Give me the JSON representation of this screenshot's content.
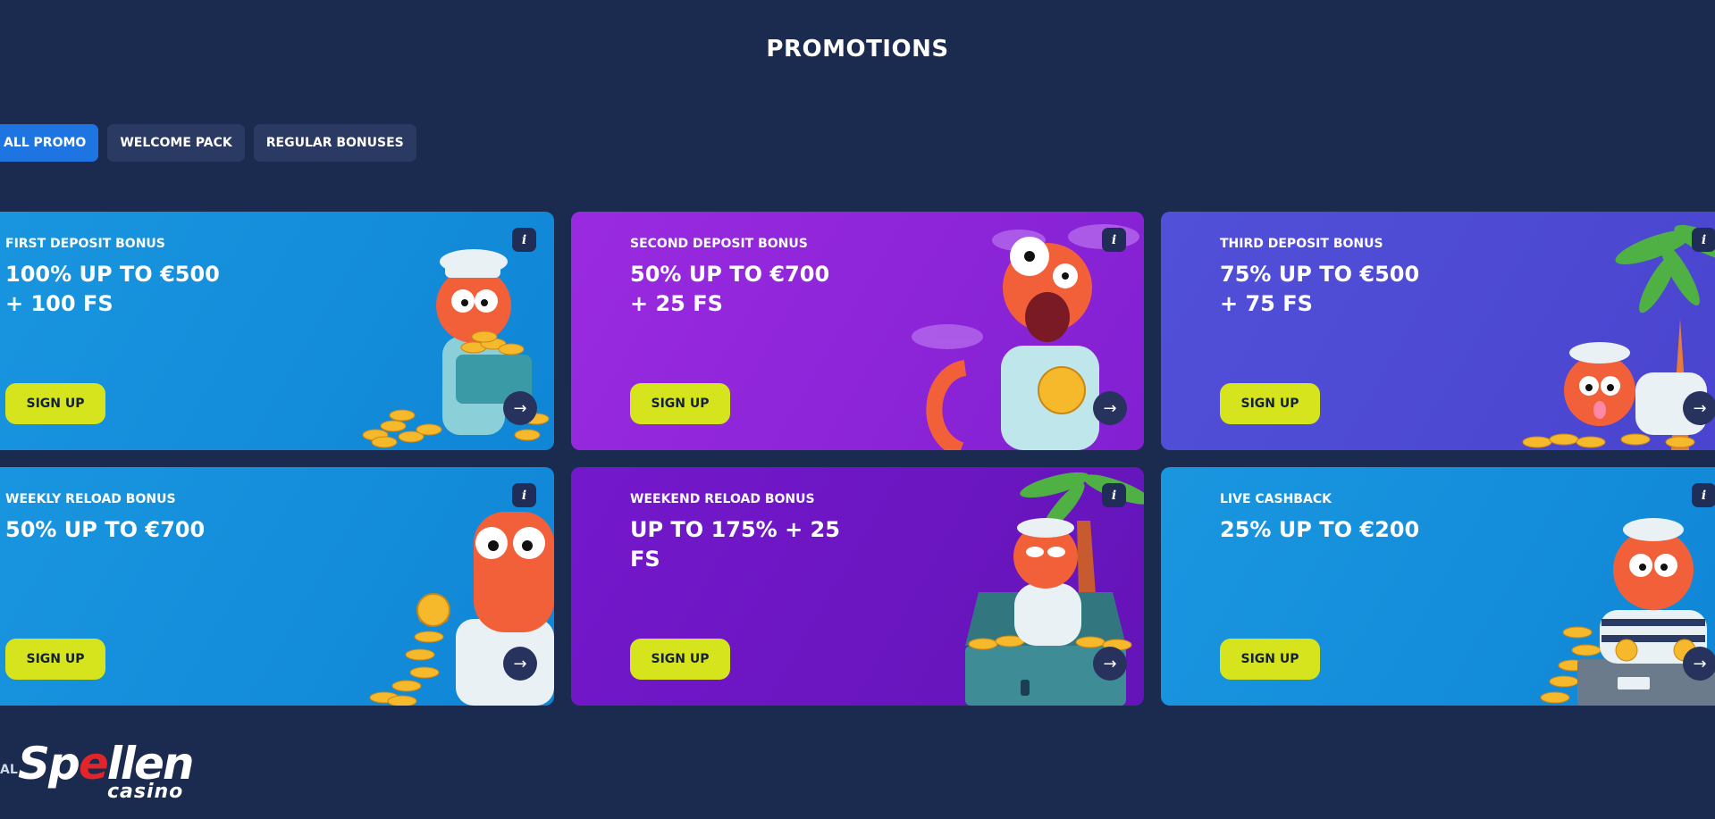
{
  "page": {
    "title": "PROMOTIONS"
  },
  "tabs": [
    {
      "label": "ALL PROMO",
      "active": true
    },
    {
      "label": "WELCOME PACK",
      "active": false
    },
    {
      "label": "REGULAR BONUSES",
      "active": false
    }
  ],
  "cards": [
    {
      "label": "FIRST DEPOSIT BONUS",
      "headline": "100% UP TO €500 + 100 FS",
      "button": "SIGN UP",
      "info": "i",
      "arrow": "→",
      "color": "#1a96df"
    },
    {
      "label": "SECOND DEPOSIT BONUS",
      "headline": "50% UP TO €700 + 25 FS",
      "button": "SIGN UP",
      "info": "i",
      "arrow": "→",
      "color": "#9a2ae0"
    },
    {
      "label": "THIRD DEPOSIT BONUS",
      "headline": "75% UP TO €500 + 75 FS",
      "button": "SIGN UP",
      "info": "i",
      "arrow": "→",
      "color": "#5150d8"
    },
    {
      "label": "WEEKLY RELOAD BONUS",
      "headline": "50% UP TO €700",
      "button": "SIGN UP",
      "info": "i",
      "arrow": "→",
      "color": "#1a96df"
    },
    {
      "label": "WEEKEND RELOAD BONUS",
      "headline": "UP TO 175% + 25 FS",
      "button": "SIGN UP",
      "info": "i",
      "arrow": "→",
      "color": "#7418cc"
    },
    {
      "label": "LIVE CASHBACK",
      "headline": "25% UP TO €200",
      "button": "SIGN UP",
      "info": "i",
      "arrow": "→",
      "color": "#1a96df"
    }
  ],
  "footer": {
    "partial_label": "AL",
    "logo_main_before": "Sp",
    "logo_main_accent": "e",
    "logo_main_after": "llen",
    "logo_sub": "casino"
  },
  "icons": {
    "info": "info-icon",
    "arrow": "arrow-right-icon"
  },
  "colors": {
    "background": "#1b2a4f",
    "accent_button": "#d5e41c",
    "active_tab": "#1e74e0",
    "logo_red": "#e2252b"
  }
}
